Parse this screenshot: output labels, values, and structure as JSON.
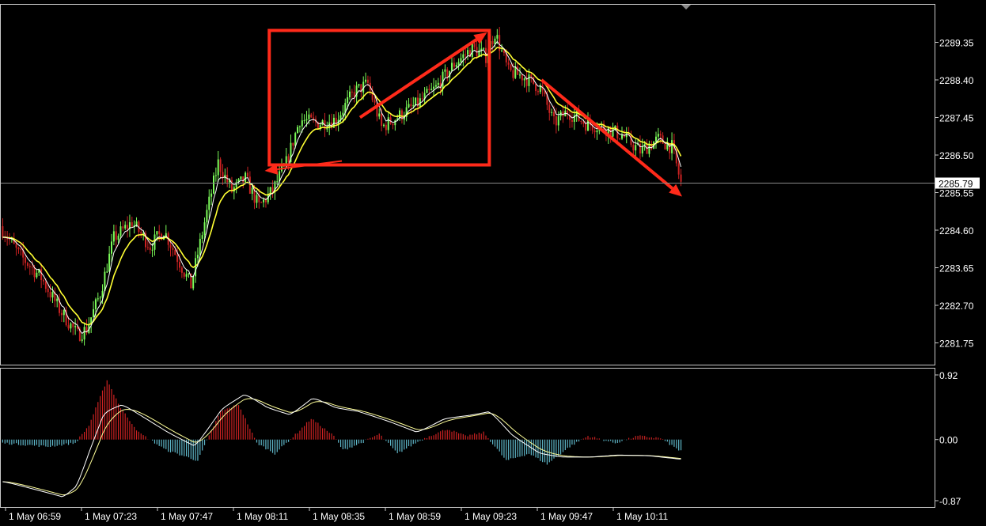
{
  "chart_data": [
    {
      "type": "candlestick",
      "price_ticks": [
        "2289.35",
        "2288.40",
        "2287.45",
        "2286.50",
        "2285.55",
        "2284.60",
        "2283.65",
        "2282.70",
        "2281.75"
      ],
      "current_price": "2285.79",
      "ylim": [
        2281.2,
        2290.3
      ],
      "time_ticks": [
        "1 May 06:59",
        "1 May 07:23",
        "1 May 07:47",
        "1 May 08:11",
        "1 May 08:35",
        "1 May 08:59",
        "1 May 09:23",
        "1 May 09:47",
        "1 May 10:11"
      ],
      "price_path": [
        [
          0,
          2284.7
        ],
        [
          8,
          2284.0
        ],
        [
          18,
          2283.4
        ],
        [
          26,
          2282.6
        ],
        [
          34,
          2281.95
        ],
        [
          38,
          2282.1
        ],
        [
          44,
          2283.0
        ],
        [
          50,
          2284.4
        ],
        [
          58,
          2284.8
        ],
        [
          66,
          2284.2
        ],
        [
          72,
          2284.6
        ],
        [
          78,
          2283.9
        ],
        [
          84,
          2283.2
        ],
        [
          90,
          2284.8
        ],
        [
          96,
          2286.3
        ],
        [
          102,
          2285.6
        ],
        [
          108,
          2285.9
        ],
        [
          114,
          2285.2
        ],
        [
          120,
          2285.6
        ],
        [
          126,
          2286.3
        ],
        [
          132,
          2287.4
        ],
        [
          140,
          2287.3
        ],
        [
          148,
          2287.4
        ],
        [
          156,
          2288.1
        ],
        [
          162,
          2288.3
        ],
        [
          168,
          2287.2
        ],
        [
          176,
          2287.5
        ],
        [
          184,
          2287.8
        ],
        [
          192,
          2288.2
        ],
        [
          200,
          2288.8
        ],
        [
          208,
          2289.2
        ],
        [
          214,
          2289.0
        ],
        [
          218,
          2289.6
        ],
        [
          224,
          2288.6
        ],
        [
          230,
          2288.5
        ],
        [
          238,
          2288.2
        ],
        [
          244,
          2287.3
        ],
        [
          250,
          2287.6
        ],
        [
          258,
          2287.3
        ],
        [
          266,
          2287.2
        ],
        [
          274,
          2287.0
        ],
        [
          282,
          2286.6
        ],
        [
          290,
          2286.9
        ],
        [
          296,
          2286.7
        ],
        [
          300,
          2285.79
        ]
      ],
      "n_bars": 300,
      "overlays": [
        {
          "color": "#ffffff",
          "kind": "fast moving average"
        },
        {
          "color": "#ffff33",
          "kind": "slow moving average"
        }
      ],
      "annotations": {
        "color": "#ff2a1a",
        "box": {
          "x": [
            118,
            215
          ],
          "y": [
            2286.25,
            2289.65
          ]
        },
        "arrows": [
          {
            "from": [
              158,
              2287.45
            ],
            "to": [
              214,
              2289.6
            ]
          },
          {
            "from": [
              150,
              2286.35
            ],
            "to": [
              116,
              2286.1
            ]
          },
          {
            "from": [
              238,
              2288.4
            ],
            "to": [
              300,
              2285.45
            ]
          }
        ]
      }
    },
    {
      "type": "histogram",
      "ticks": [
        "0.92",
        "0.00",
        "-0.87"
      ],
      "ylim": [
        -0.87,
        0.92
      ],
      "positive_color": "#cc2222",
      "negative_color": "#5fb7c9",
      "line_colors": [
        "#ffffff",
        "#ffff99"
      ],
      "osc_path": [
        [
          0,
          -0.05
        ],
        [
          20,
          -0.1
        ],
        [
          32,
          -0.05
        ],
        [
          38,
          0.2
        ],
        [
          46,
          0.85
        ],
        [
          52,
          0.45
        ],
        [
          60,
          0.1
        ],
        [
          72,
          -0.15
        ],
        [
          86,
          -0.3
        ],
        [
          96,
          0.4
        ],
        [
          104,
          0.5
        ],
        [
          112,
          -0.05
        ],
        [
          120,
          -0.2
        ],
        [
          130,
          0.1
        ],
        [
          136,
          0.3
        ],
        [
          146,
          0.05
        ],
        [
          150,
          -0.15
        ],
        [
          158,
          -0.05
        ],
        [
          166,
          0.08
        ],
        [
          174,
          -0.2
        ],
        [
          182,
          -0.05
        ],
        [
          188,
          0.05
        ],
        [
          196,
          0.15
        ],
        [
          204,
          0.05
        ],
        [
          212,
          0.1
        ],
        [
          222,
          -0.3
        ],
        [
          232,
          -0.2
        ],
        [
          240,
          -0.35
        ],
        [
          250,
          -0.1
        ],
        [
          258,
          0.05
        ],
        [
          270,
          -0.05
        ],
        [
          280,
          0.05
        ],
        [
          290,
          0.02
        ],
        [
          298,
          -0.15
        ]
      ],
      "signal_path": [
        [
          0,
          -0.6
        ],
        [
          18,
          -0.75
        ],
        [
          26,
          -0.82
        ],
        [
          32,
          -0.65
        ],
        [
          38,
          -0.1
        ],
        [
          44,
          0.4
        ],
        [
          52,
          0.5
        ],
        [
          62,
          0.3
        ],
        [
          72,
          0.1
        ],
        [
          84,
          -0.1
        ],
        [
          96,
          0.45
        ],
        [
          106,
          0.65
        ],
        [
          116,
          0.45
        ],
        [
          126,
          0.35
        ],
        [
          136,
          0.6
        ],
        [
          146,
          0.45
        ],
        [
          156,
          0.4
        ],
        [
          170,
          0.25
        ],
        [
          182,
          0.1
        ],
        [
          194,
          0.3
        ],
        [
          206,
          0.35
        ],
        [
          214,
          0.4
        ],
        [
          224,
          0.05
        ],
        [
          236,
          -0.2
        ],
        [
          246,
          -0.25
        ],
        [
          258,
          -0.25
        ],
        [
          270,
          -0.22
        ],
        [
          284,
          -0.23
        ],
        [
          298,
          -0.28
        ]
      ]
    }
  ]
}
